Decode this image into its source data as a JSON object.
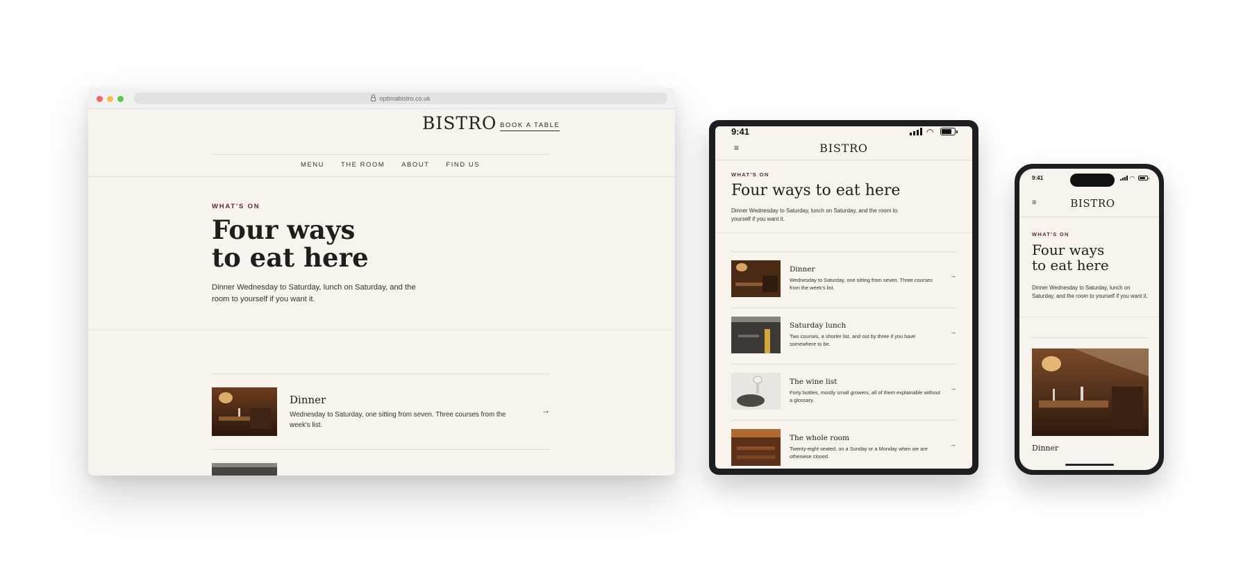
{
  "brand": "BISTRO",
  "browser": {
    "url": "optimabistro.co.uk"
  },
  "desktop": {
    "book_label": "BOOK A TABLE",
    "nav": [
      "MENU",
      "THE ROOM",
      "ABOUT",
      "FIND US"
    ]
  },
  "hero": {
    "eyebrow": "WHAT'S ON",
    "title_line1": "Four ways",
    "title_line2": "to eat here",
    "title_full": "Four ways to eat here",
    "lede": "Dinner Wednesday to Saturday, lunch on Saturday, and the room to yourself if you want it."
  },
  "items": [
    {
      "title": "Dinner",
      "desc": "Wednesday to Saturday, one sitting from seven. Three courses from the week's list."
    },
    {
      "title": "Saturday lunch",
      "desc": "Two courses, a shorter list, and out by three if you have somewhere to be."
    },
    {
      "title": "The wine list",
      "desc": "Forty bottles, mostly small growers, all of them explainable without a glossary."
    },
    {
      "title": "The whole room",
      "desc": "Twenty-eight seated, on a Sunday or a Monday when we are otherwise closed."
    }
  ],
  "icons": {
    "arrow": "arrow-right-icon",
    "menu": "hamburger-icon",
    "lock": "lock-icon"
  },
  "tablet": {
    "time": "9:41"
  },
  "phone": {
    "time": "9:41"
  },
  "colors": {
    "page_bg": "#f8f3ec",
    "eyebrow": "#5a2c26",
    "ink": "#221d1a"
  }
}
